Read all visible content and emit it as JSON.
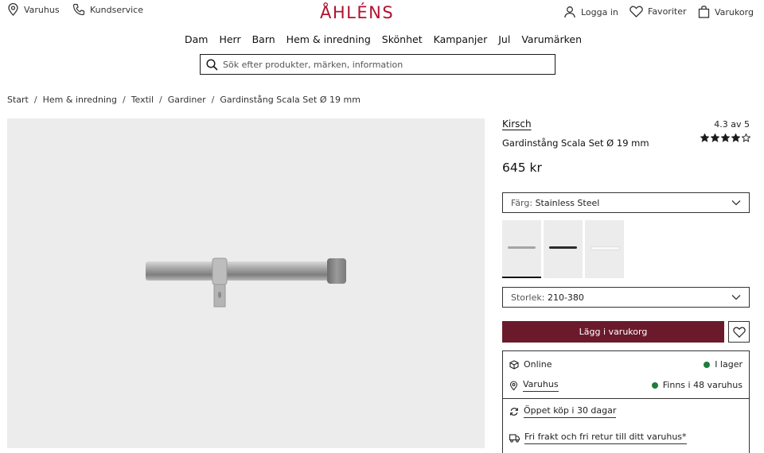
{
  "header": {
    "store_link": "Varuhus",
    "service_link": "Kundservice",
    "logo": "ÅHLÉNS",
    "login": "Logga in",
    "favorites": "Favoriter",
    "cart": "Varukorg"
  },
  "nav": [
    "Dam",
    "Herr",
    "Barn",
    "Hem & inredning",
    "Skönhet",
    "Kampanjer",
    "Jul",
    "Varumärken"
  ],
  "search": {
    "placeholder": "Sök efter produkter, märken, information"
  },
  "breadcrumb": [
    "Start",
    "Hem & inredning",
    "Textil",
    "Gardiner",
    "Gardinstång Scala Set Ø 19 mm"
  ],
  "product": {
    "brand": "Kirsch",
    "name": "Gardinstång Scala Set Ø 19 mm",
    "rating_text": "4.3 av 5",
    "rating": 4.3,
    "rating_max": 5,
    "price": "645 kr",
    "color_label": "Färg:",
    "color_value": "Stainless Steel",
    "size_label": "Storlek:",
    "size_value": "210-380",
    "add_to_cart": "Lägg i varukorg",
    "swatch_icons": [
      "steel-rod-swatch",
      "black-rod-swatch",
      "white-rod-swatch"
    ]
  },
  "availability": {
    "online_label": "Online",
    "online_status": "I lager",
    "store_label": "Varuhus",
    "store_status": "Finns i 48 varuhus",
    "open_purchase": "Öppet köp i 30 dagar",
    "free_shipping": "Fri frakt och fri retur till ditt varuhus*"
  },
  "colors": {
    "brand": "#b3122f",
    "cart_button": "#6b1a2c",
    "in_stock": "#1e7d3a",
    "panel": "#ececec"
  }
}
